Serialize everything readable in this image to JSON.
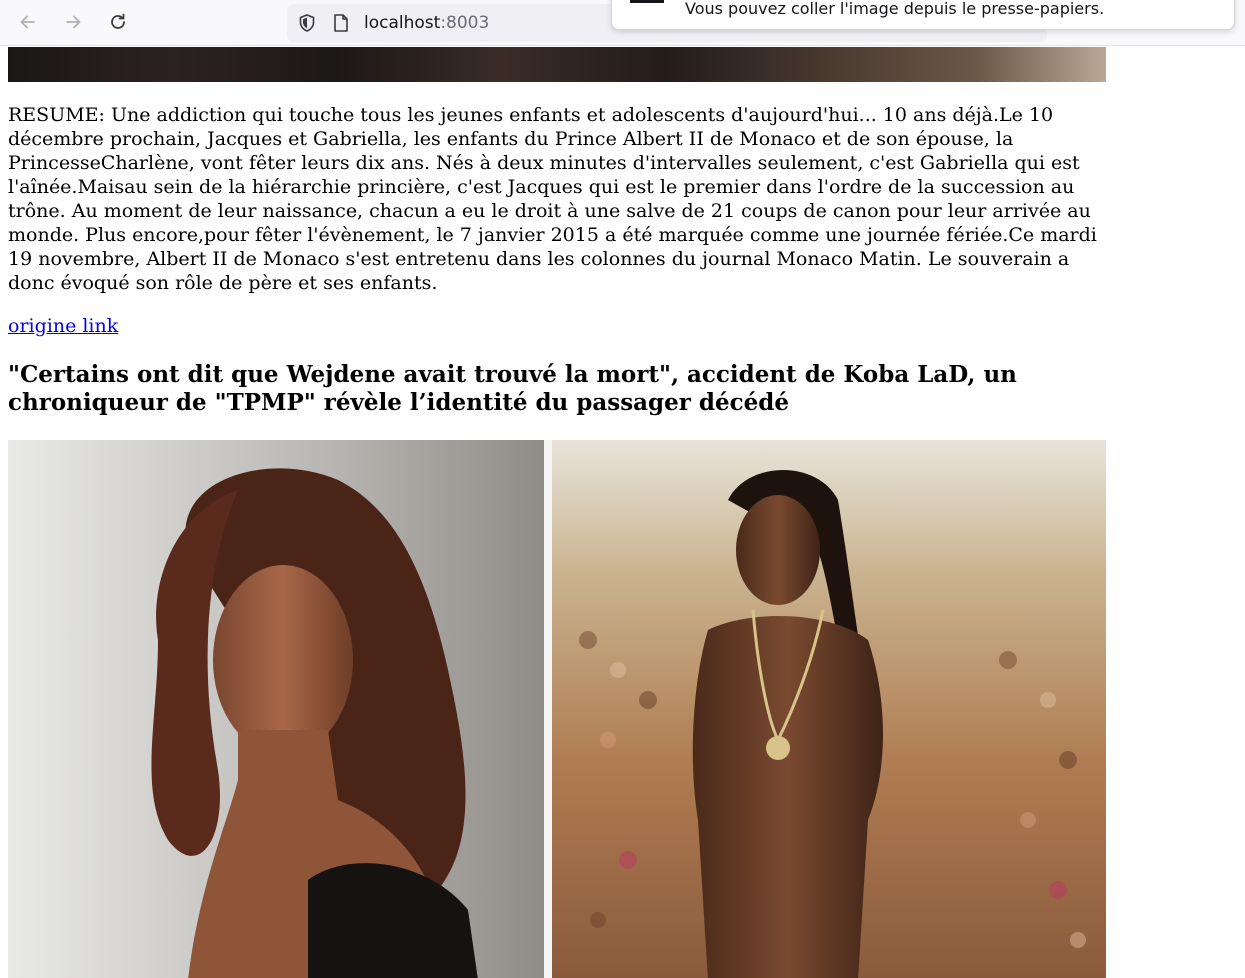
{
  "browser": {
    "url_host": "localhost",
    "url_port": ":8003",
    "notification_text": "Vous pouvez coller l'image depuis le presse-papiers."
  },
  "article": {
    "resume": "RESUME: Une addiction qui touche tous les jeunes enfants et adolescents d'aujourd'hui... 10 ans déjà.Le 10 décembre prochain, Jacques et Gabriella, les enfants du Prince Albert II de Monaco et de son épouse, la PrincesseCharlène, vont fêter leurs dix ans. Nés à deux minutes d'intervalles seulement, c'est Gabriella qui est l'aînée.Maisau sein de la hiérarchie princière, c'est Jacques qui est le premier dans l'ordre de la succession au trône. Au moment de leur naissance, chacun a eu le droit à une salve de 21 coups de canon pour leur arrivée au monde. Plus encore,pour fêter l'évènement, le 7 janvier 2015 a été marquée comme une journée fériée.Ce mardi 19 novembre, Albert II de Monaco s'est entretenu dans les colonnes du journal Monaco Matin. Le souverain a donc évoqué son rôle de père et ses enfants.",
    "origin_link": "origine link"
  },
  "next_article": {
    "headline": "\"Certains ont dit que Wejdene avait trouvé la mort\", accident de Koba LaD, un chroniqueur de \"TPMP\" révèle l’identité du passager décédé"
  },
  "colors": {
    "link": "#0000ee",
    "text": "#000000",
    "toolbar_bg": "#f9f9fb",
    "urlbar_bg": "#f0f0f4"
  }
}
